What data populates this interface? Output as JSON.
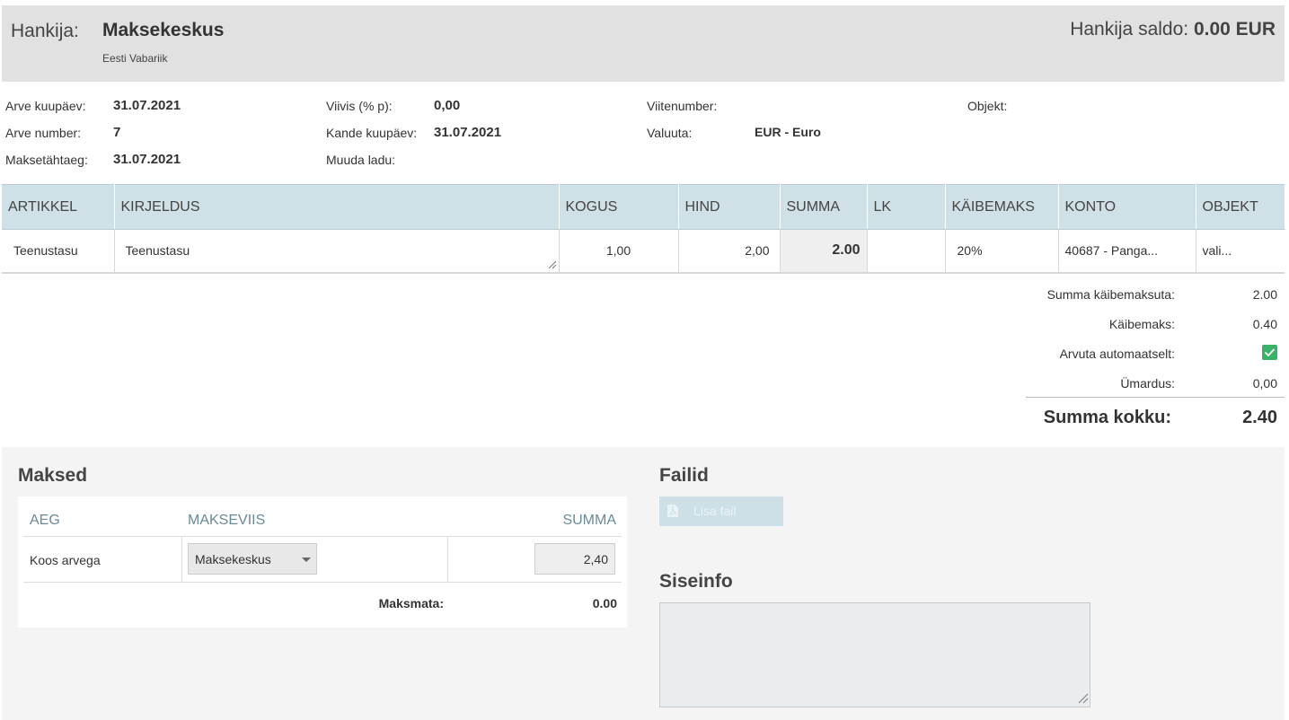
{
  "header": {
    "supplier_label": "Hankija:",
    "supplier_name": "Maksekeskus",
    "supplier_country": "Eesti Vabariik",
    "balance_label": "Hankija saldo:",
    "balance_value": "0.00 EUR"
  },
  "meta": {
    "invoice_date_label": "Arve kuupäev:",
    "invoice_date": "31.07.2021",
    "invoice_number_label": "Arve number:",
    "invoice_number": "7",
    "due_date_label": "Maksetähtaeg:",
    "due_date": "31.07.2021",
    "penalty_label": "Viivis (% p):",
    "penalty": "0,00",
    "entry_date_label": "Kande kuupäev:",
    "entry_date": "31.07.2021",
    "warehouse_label": "Muuda ladu:",
    "reference_label": "Viitenumber:",
    "currency_label": "Valuuta:",
    "currency": "EUR - Euro",
    "object_label": "Objekt:"
  },
  "lines_table": {
    "columns": [
      "ARTIKKEL",
      "KIRJELDUS",
      "KOGUS",
      "HIND",
      "SUMMA",
      "LK",
      "KÄIBEMAKS",
      "KONTO",
      "OBJEKT"
    ],
    "rows": [
      {
        "article": "Teenustasu",
        "description": "Teenustasu",
        "quantity": "1,00",
        "price": "2,00",
        "sum": "2.00",
        "lk": "",
        "vat": "20%",
        "account": "40687 - Panga...",
        "object": "vali..."
      }
    ]
  },
  "totals": {
    "net_label": "Summa käibemaksuta:",
    "net": "2.00",
    "vat_label": "Käibemaks:",
    "vat": "0.40",
    "auto_label": "Arvuta automaatselt:",
    "auto_checked": true,
    "rounding_label": "Ümardus:",
    "rounding": "0,00",
    "total_label": "Summa kokku:",
    "total": "2.40"
  },
  "payments": {
    "title": "Maksed",
    "columns": [
      "AEG",
      "MAKSEVIIS",
      "SUMMA"
    ],
    "row": {
      "time": "Koos arvega",
      "method": "Maksekeskus",
      "amount": "2,40"
    },
    "unpaid_label": "Maksmata:",
    "unpaid": "0.00"
  },
  "files": {
    "title": "Failid",
    "add_button": "Lisa fail"
  },
  "internal": {
    "title": "Siseinfo",
    "notes_value": ""
  },
  "colors": {
    "header_bg": "#e1e1e1",
    "table_header_bg": "#cfe0e6",
    "checkbox_green": "#3bb26a",
    "bottom_bg": "#f4f4f4",
    "muted_blue": "#6b8a99"
  }
}
